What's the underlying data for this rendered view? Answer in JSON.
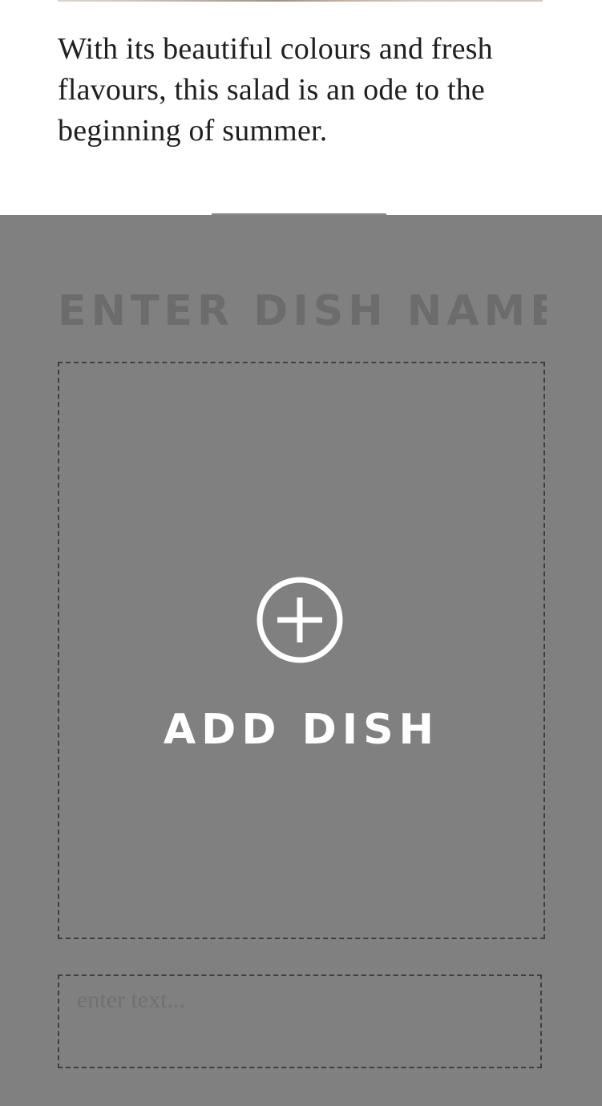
{
  "article": {
    "description": "With its beautiful colours and fresh flavours, this salad is an ode to the beginning of summer."
  },
  "editor": {
    "dish_name_placeholder": "ENTER DISH NAME",
    "add_dish_label": "ADD DISH",
    "add_icon": "plus-circle-icon",
    "text_placeholder": "enter text..."
  },
  "colors": {
    "editor_background": "#7f807f",
    "dashed_border": "#3f4040",
    "placeholder_text": "#6b6c6b",
    "add_dish_text": "#ffffff"
  }
}
